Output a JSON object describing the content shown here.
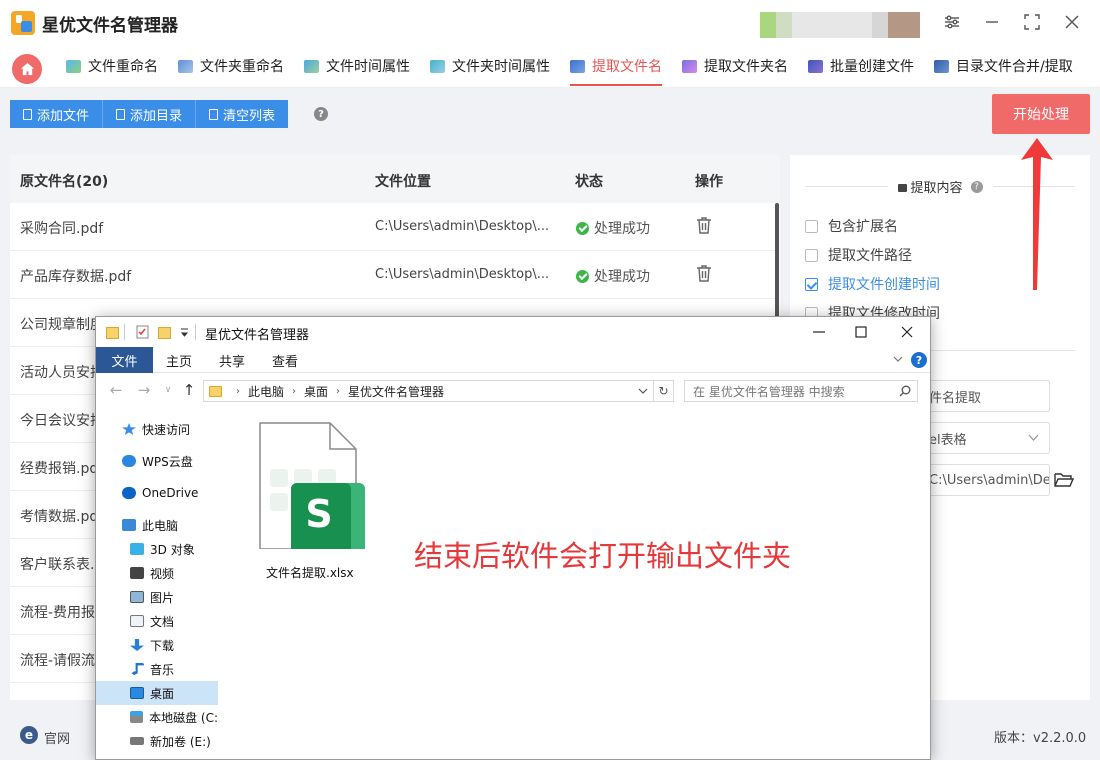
{
  "app": {
    "title": "星优文件名管理器",
    "accent_color": "#3b8ee8",
    "brand_red": "#f06a6a"
  },
  "tabs": [
    {
      "label": "文件重命名",
      "icon": "rename-file-icon",
      "active": false
    },
    {
      "label": "文件夹重命名",
      "icon": "rename-folder-icon",
      "active": false
    },
    {
      "label": "文件时间属性",
      "icon": "file-time-icon",
      "active": false
    },
    {
      "label": "文件夹时间属性",
      "icon": "folder-time-icon",
      "active": false
    },
    {
      "label": "提取文件名",
      "icon": "extract-filename-icon",
      "active": true
    },
    {
      "label": "提取文件夹名",
      "icon": "extract-foldername-icon",
      "active": false
    },
    {
      "label": "批量创建文件",
      "icon": "batch-create-icon",
      "active": false
    },
    {
      "label": "目录文件合并/提取",
      "icon": "merge-extract-icon",
      "active": false
    }
  ],
  "toolbar": {
    "add_file": "添加文件",
    "add_dir": "添加目录",
    "clear_list": "清空列表",
    "start": "开始处理"
  },
  "table": {
    "headers": {
      "name": "原文件名(20)",
      "location": "文件位置",
      "status": "状态",
      "action": "操作"
    },
    "rows": [
      {
        "name": "采购合同.pdf",
        "location": "C:\\Users\\admin\\Desktop\\...",
        "status": "处理成功"
      },
      {
        "name": "产品库存数据.pdf",
        "location": "C:\\Users\\admin\\Desktop\\...",
        "status": "处理成功"
      },
      {
        "name": "公司规章制度",
        "location": "",
        "status": ""
      },
      {
        "name": "活动人员安排",
        "location": "",
        "status": ""
      },
      {
        "name": "今日会议安排",
        "location": "",
        "status": ""
      },
      {
        "name": "经费报销.pd",
        "location": "",
        "status": ""
      },
      {
        "name": "考情数据.pd",
        "location": "",
        "status": ""
      },
      {
        "name": "客户联系表.",
        "location": "",
        "status": ""
      },
      {
        "name": "流程-费用报",
        "location": "",
        "status": ""
      },
      {
        "name": "流程-请假流",
        "location": "",
        "status": ""
      }
    ]
  },
  "settings": {
    "section_title": "提取内容",
    "options": [
      {
        "label": "包含扩展名",
        "checked": false
      },
      {
        "label": "提取文件路径",
        "checked": false
      },
      {
        "label": "提取文件创建时间",
        "checked": true
      },
      {
        "label": "提取文件修改时间",
        "checked": false
      }
    ],
    "output_name": "件名提取",
    "output_format": "el表格",
    "output_path": "C:\\Users\\admin\\Des"
  },
  "bottom": {
    "site": "官网",
    "version": "版本：v2.2.0.0"
  },
  "explorer": {
    "title": "星优文件名管理器",
    "ribbon_tabs": [
      "文件",
      "主页",
      "共享",
      "查看"
    ],
    "breadcrumb": [
      "此电脑",
      "桌面",
      "星优文件名管理器"
    ],
    "search_placeholder": "在 星优文件名管理器 中搜索",
    "sidebar": [
      {
        "label": "快速访问",
        "icon": "star-icon"
      },
      {
        "label": "WPS云盘",
        "icon": "cloud-icon"
      },
      {
        "label": "OneDrive",
        "icon": "onedrive-icon"
      },
      {
        "label": "此电脑",
        "icon": "computer-icon"
      },
      {
        "label": "3D 对象",
        "icon": "cube-icon"
      },
      {
        "label": "视频",
        "icon": "video-icon"
      },
      {
        "label": "图片",
        "icon": "picture-icon"
      },
      {
        "label": "文档",
        "icon": "document-icon"
      },
      {
        "label": "下载",
        "icon": "download-icon"
      },
      {
        "label": "音乐",
        "icon": "music-icon"
      },
      {
        "label": "桌面",
        "icon": "desktop-icon",
        "selected": true
      },
      {
        "label": "本地磁盘 (C:",
        "icon": "disk-icon"
      },
      {
        "label": "新加卷 (E:)",
        "icon": "drive-icon"
      }
    ],
    "file_name": "文件名提取.xlsx",
    "file_icon": "xlsx-file-icon"
  },
  "annotation": {
    "text": "结束后软件会打开输出文件夹",
    "color": "#e5383b"
  }
}
